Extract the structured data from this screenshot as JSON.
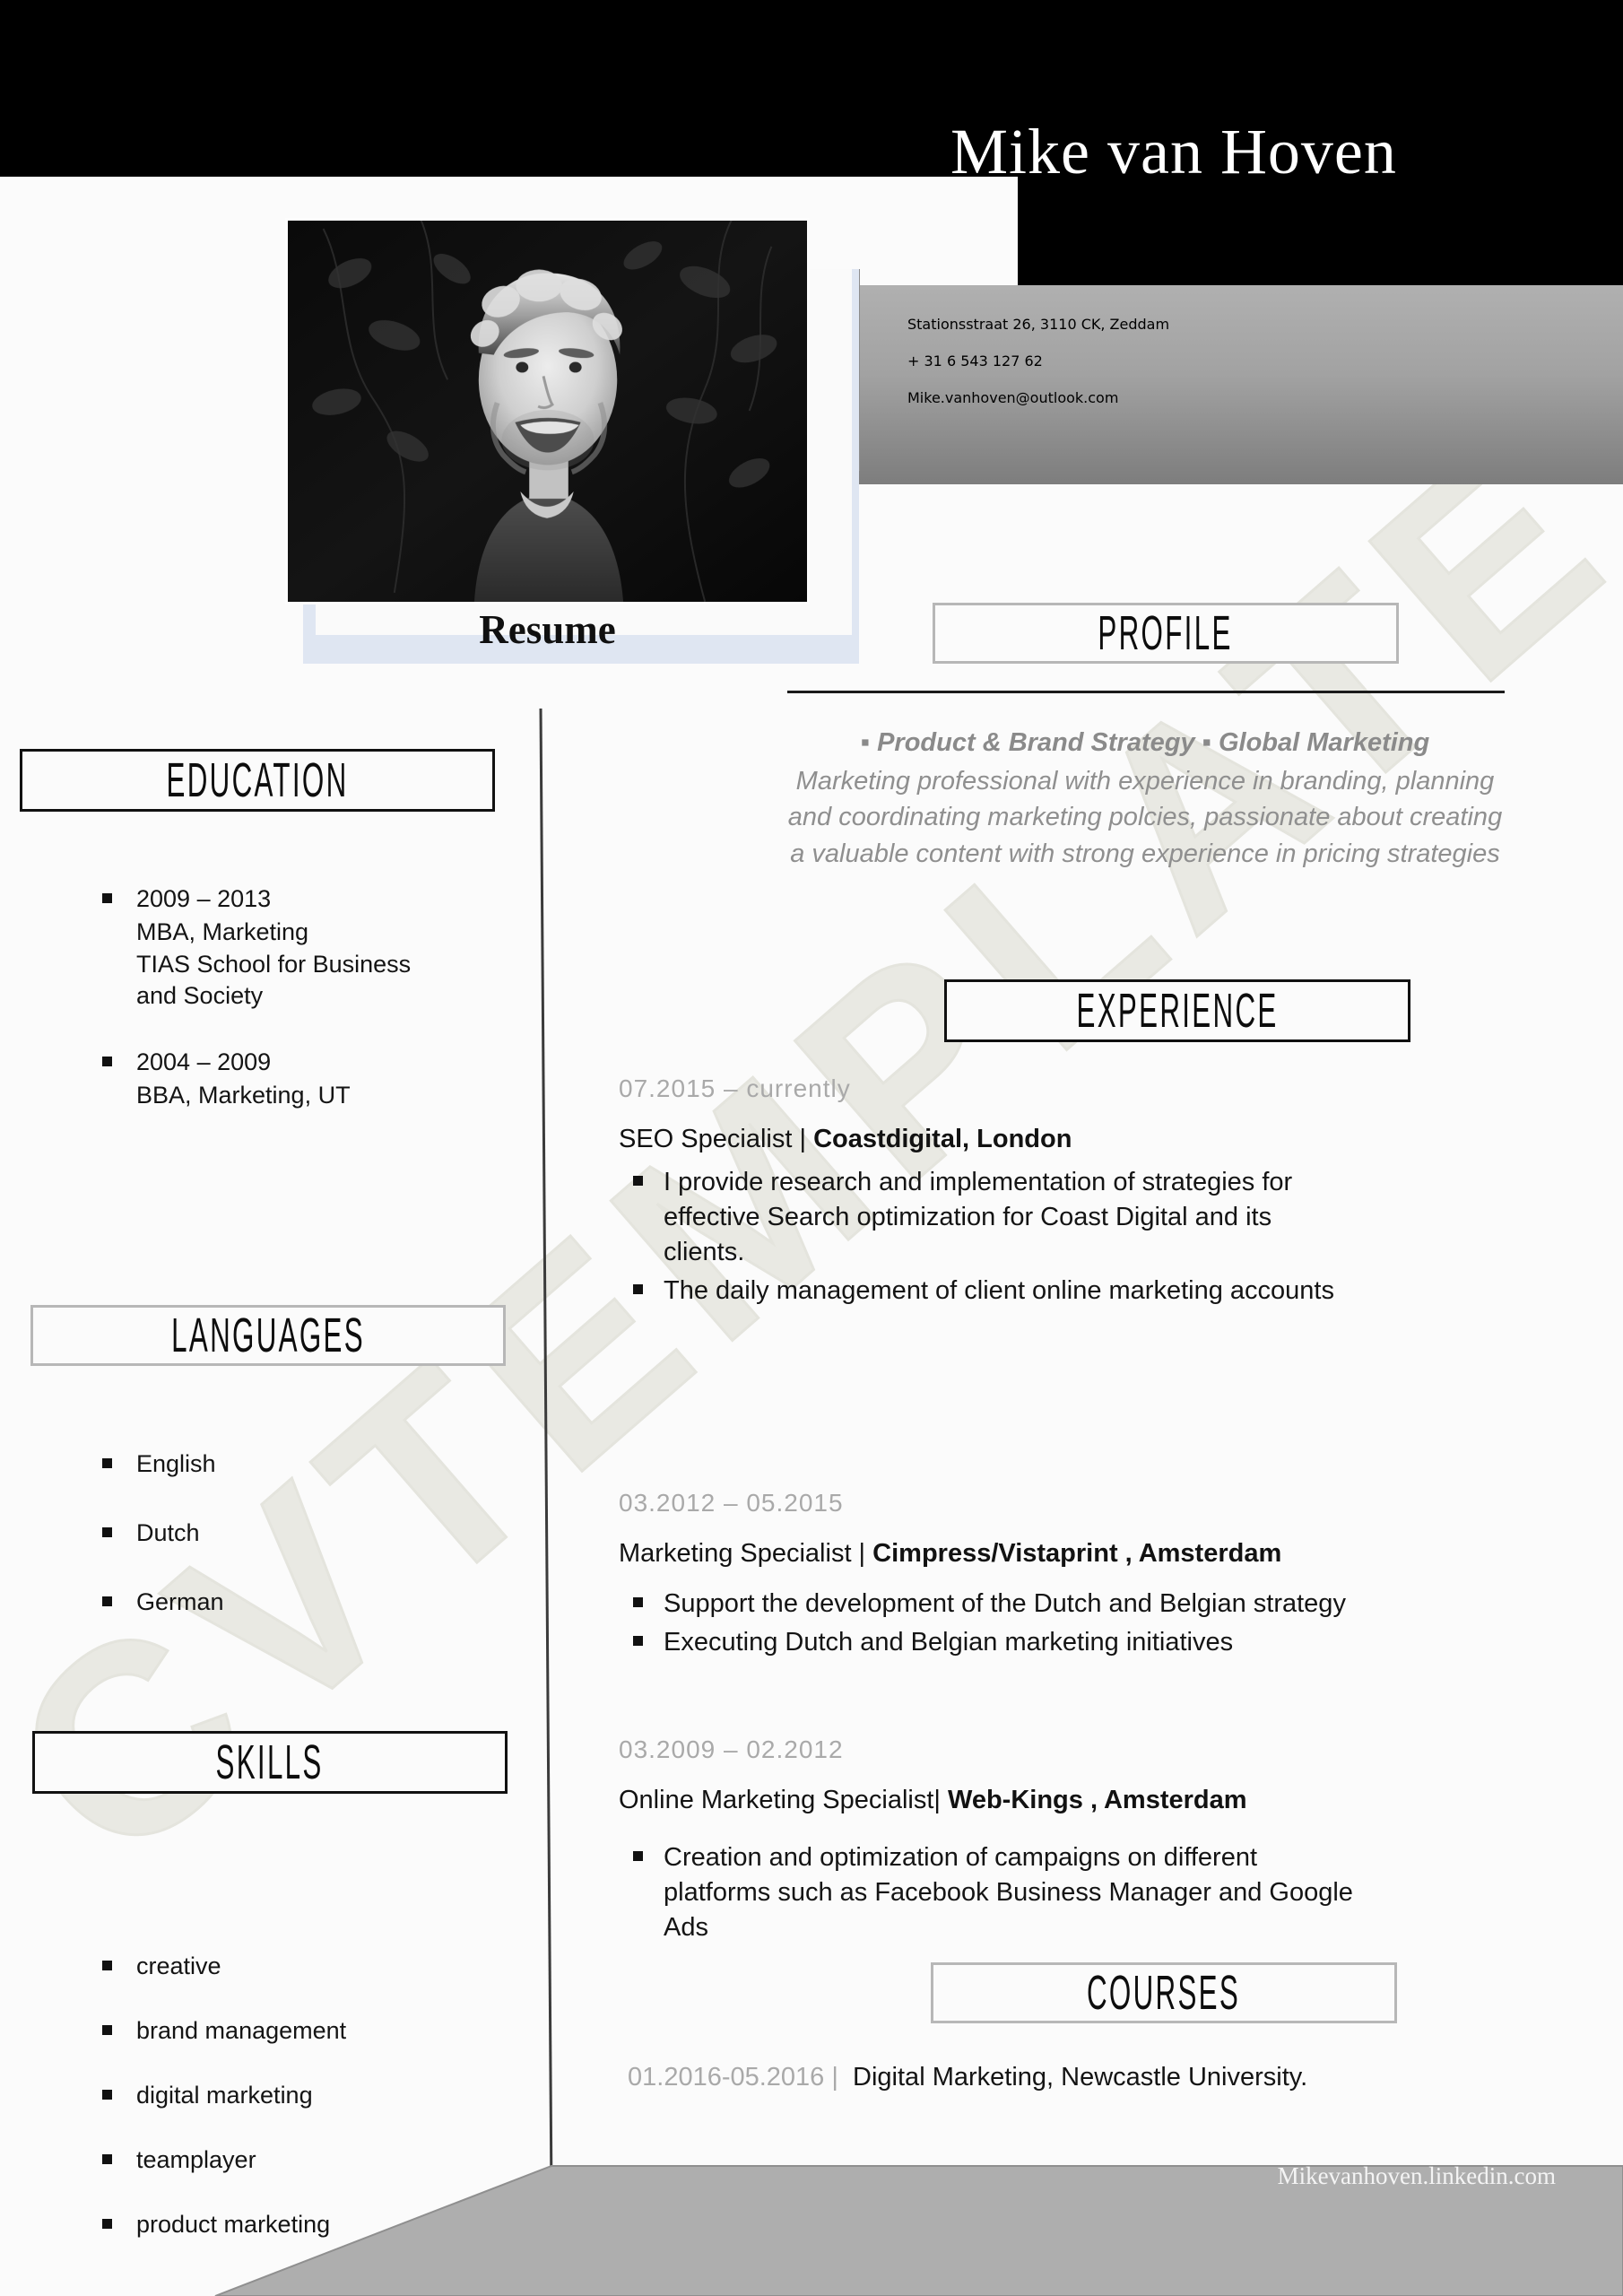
{
  "document_title": "Resume",
  "header": {
    "name": "Mike van Hoven",
    "contact": {
      "address": "Stationsstraat 26, 3110 CK,  Zeddam",
      "phone": "+ 31 6 543 127 62",
      "email": "Mike.vanhoven@outlook.com"
    }
  },
  "watermark": "CVTEMPLATE",
  "photo_caption": "Resume",
  "left_column": {
    "education": {
      "heading": "EDUCATION",
      "entries": [
        {
          "years": "2009 – 2013",
          "degree": "MBA, Marketing",
          "school_line1": "TIAS School for Business",
          "school_line2": "and Society"
        },
        {
          "years": "2004 – 2009",
          "degree": "BBA, Marketing, UT",
          "school_line1": "",
          "school_line2": ""
        }
      ]
    },
    "languages": {
      "heading": "LANGUAGES",
      "items": [
        "English",
        "Dutch",
        "German"
      ]
    },
    "skills": {
      "heading": "SKILLS",
      "items": [
        "creative",
        "brand management",
        "digital marketing",
        "teamplayer",
        "product marketing"
      ]
    }
  },
  "right_column": {
    "profile": {
      "heading": "PROFILE",
      "tagline": "▪ Product & Brand Strategy ▪ Global Marketing",
      "body": "Marketing professional with experience in branding, planning and coordinating marketing polcies, passionate about creating a valuable content with strong experience in pricing strategies"
    },
    "experience": {
      "heading": "EXPERIENCE",
      "jobs": [
        {
          "dates": "07.2015  –   currently",
          "role": "SEO Specialist | ",
          "company": "Coastdigital, London",
          "bullets": [
            "I provide research and implementation of strategies for effective Search optimization for Coast Digital and its clients.",
            "The daily management of client online marketing accounts"
          ]
        },
        {
          "dates": "03.2012  –   05.2015",
          "role": "Marketing Specialist | ",
          "company": "Cimpress/Vistaprint , Amsterdam",
          "bullets": [
            "Support the development of the Dutch and Belgian strategy",
            "Executing Dutch and Belgian marketing initiatives"
          ]
        },
        {
          "dates": "03.2009  –   02.2012",
          "role": "Online Marketing Specialist| ",
          "company": "Web-Kings ,  Amsterdam",
          "bullets": [
            "Creation and optimization of campaigns on different platforms such as Facebook Business Manager and Google Ads"
          ]
        }
      ]
    },
    "courses": {
      "heading": "COURSES",
      "entries": [
        {
          "dates": "01.2016-05.2016",
          "separator": "|",
          "title": "Digital  Marketing, Newcastle University."
        }
      ]
    }
  },
  "footer": {
    "link": "Mikevanhoven.linkedin.com"
  },
  "colors": {
    "black": "#000000",
    "page_bg": "#fbfbfb",
    "frame_blue": "#dfe6f2",
    "muted_gray": "#a9a9a9",
    "footer_gray": "#aeaeae",
    "watermark": "#e9e9e3"
  }
}
